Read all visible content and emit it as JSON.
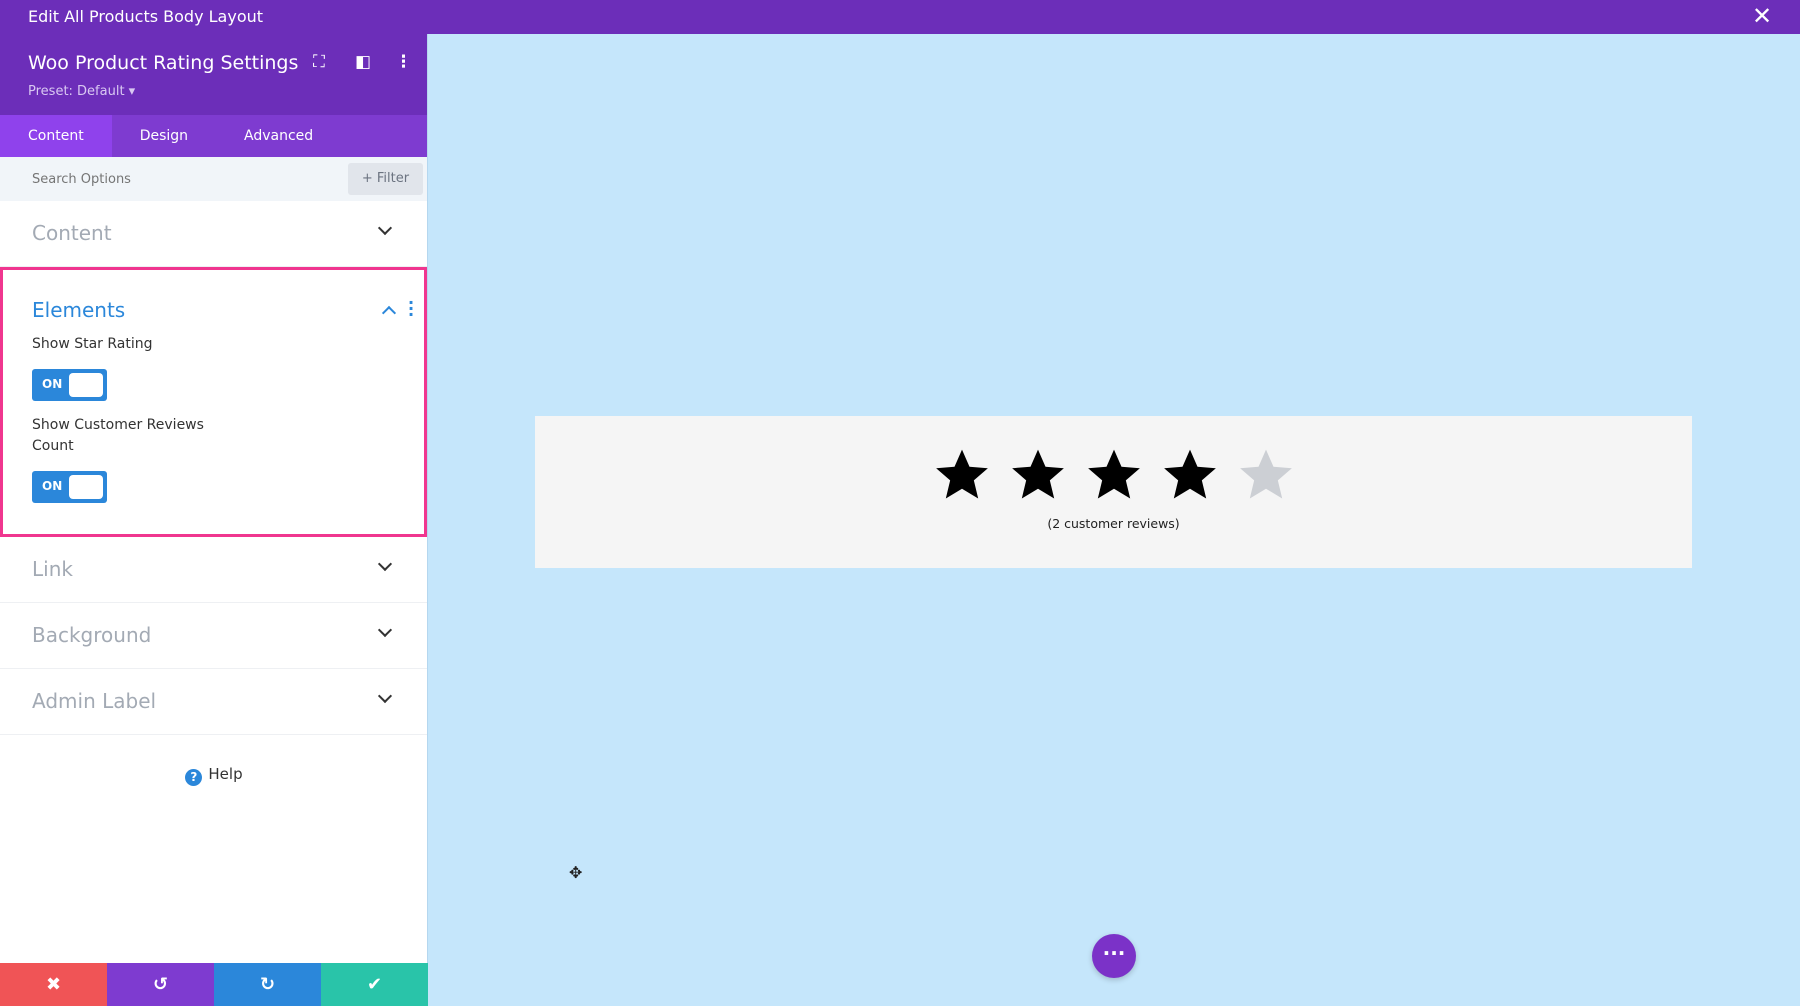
{
  "window": {
    "title": "Edit All Products Body Layout",
    "close_icon": "close-icon"
  },
  "panel": {
    "title": "Woo Product Rating Settings",
    "preset": "Preset: Default ▾",
    "tabs": [
      {
        "label": "Content",
        "active": true
      },
      {
        "label": "Design"
      },
      {
        "label": "Advanced"
      }
    ],
    "search": {
      "placeholder": "Search Options",
      "filter_label": "+ Filter"
    },
    "sections": {
      "content": "Content",
      "link": "Link",
      "background": "Background",
      "admin_label": "Admin Label"
    },
    "elements": {
      "title": "Elements",
      "show_star_rating": {
        "label": "Show Star Rating",
        "value": "ON"
      },
      "show_reviews_count": {
        "label": "Show Customer Reviews Count",
        "value": "ON"
      }
    },
    "help": "Help",
    "bottom": {
      "colors": {
        "cancel": "#f05456",
        "undo": "#7e3bd0",
        "redo": "#2b87da",
        "save": "#29c4a9"
      }
    }
  },
  "preview": {
    "rating": 4,
    "max_rating": 5,
    "reviews_text": "(2 customer reviews)",
    "star_color": "#000000",
    "empty_star_color": "#cccfd4"
  },
  "colors": {
    "accent": "#6c2eb9",
    "highlight": "#f0368f",
    "canvas": "#c5e6fb"
  }
}
